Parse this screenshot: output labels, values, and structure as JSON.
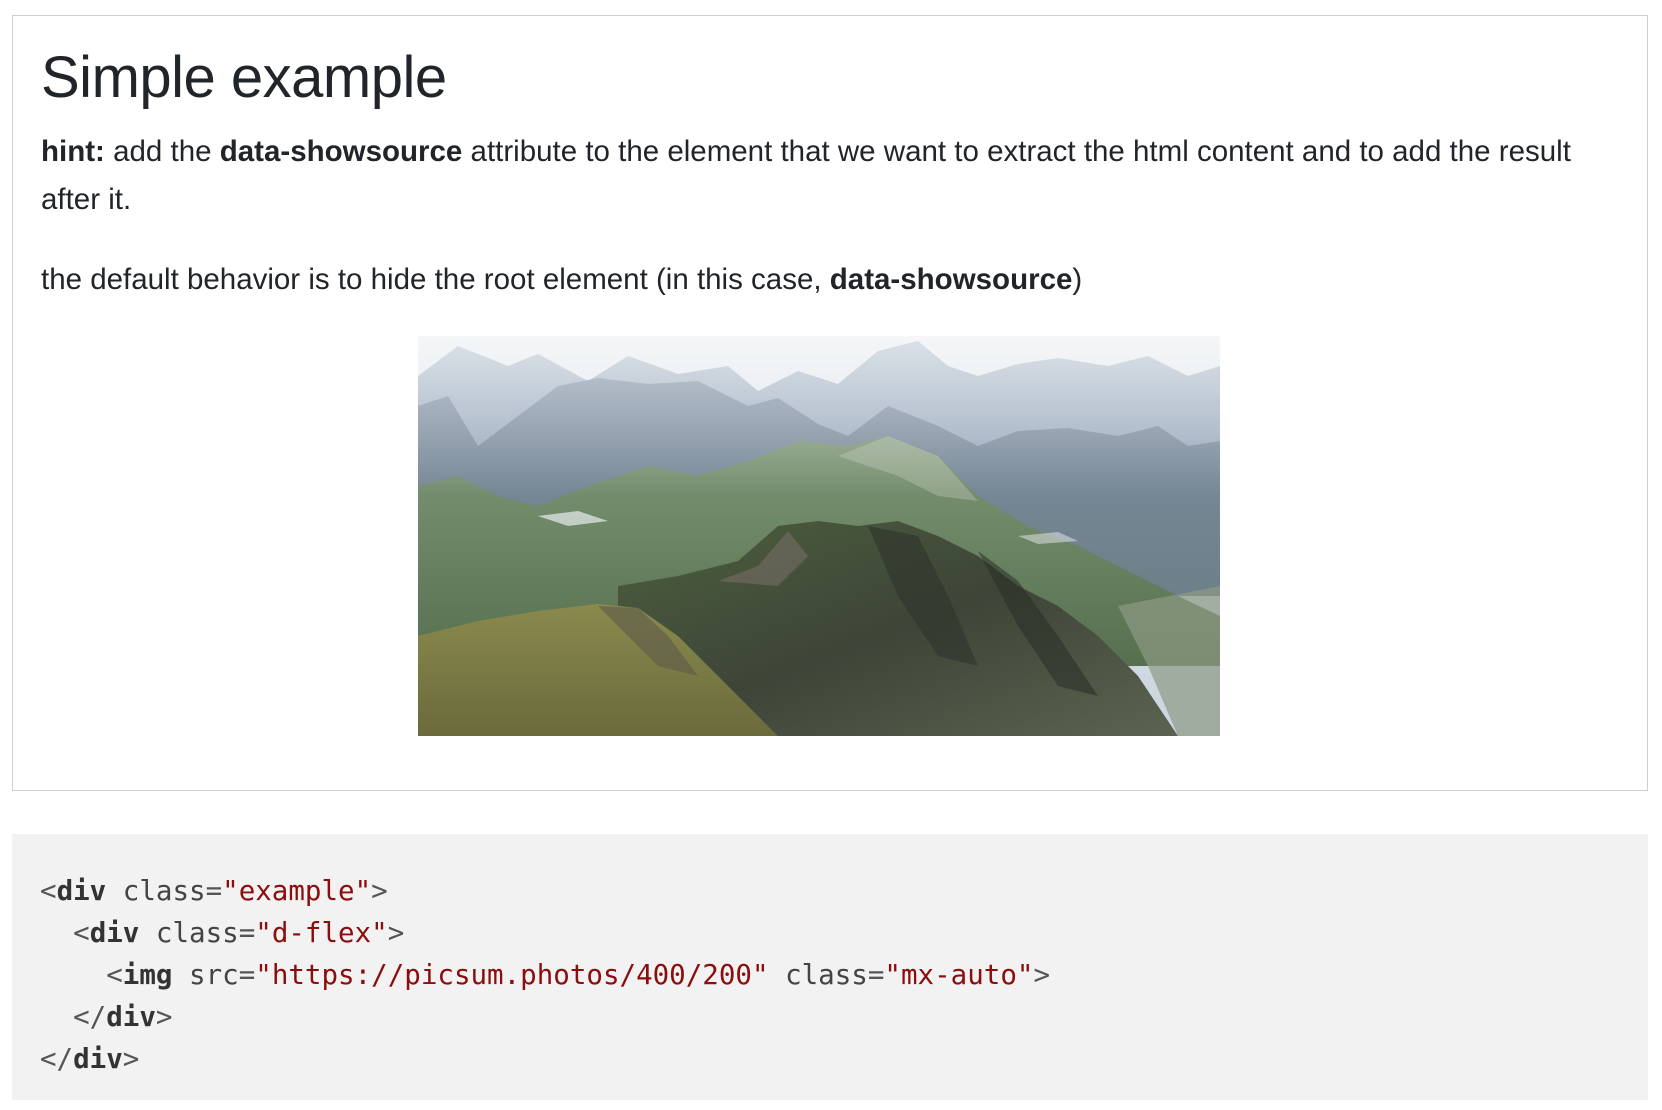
{
  "example": {
    "title": "Simple example",
    "hint": {
      "label": "hint:",
      "text_before": " add the ",
      "attribute": "data-showsource",
      "text_after": " attribute to the element that we want to extract the html content and to add the result after it."
    },
    "behavior": {
      "text_before": "the default behavior is to hide the root element (in this case, ",
      "attribute": "data-showsource",
      "text_after": ")"
    },
    "image": {
      "subject": "mountain landscape photo"
    }
  },
  "code": {
    "line1": {
      "open": "<",
      "tag": "div",
      "attr": " class",
      "eq": "=",
      "value": "\"example\"",
      "close": ">"
    },
    "line2": {
      "indent": "  ",
      "open": "<",
      "tag": "div",
      "attr": " class",
      "eq": "=",
      "value": "\"d-flex\"",
      "close": ">"
    },
    "line3": {
      "indent": "    ",
      "open": "<",
      "tag": "img",
      "attr1": " src",
      "eq1": "=",
      "value1": "\"https://picsum.photos/400/200\"",
      "attr2": " class",
      "eq2": "=",
      "value2": "\"mx-auto\"",
      "close": ">"
    },
    "line4": {
      "indent": "  ",
      "open": "</",
      "tag": "div",
      "close": ">"
    },
    "line5": {
      "open": "</",
      "tag": "div",
      "close": ">"
    }
  },
  "colors": {
    "code_background": "#f2f2f2",
    "string": "#8b0d0d",
    "border": "#cfcfcf",
    "text": "#212529"
  }
}
